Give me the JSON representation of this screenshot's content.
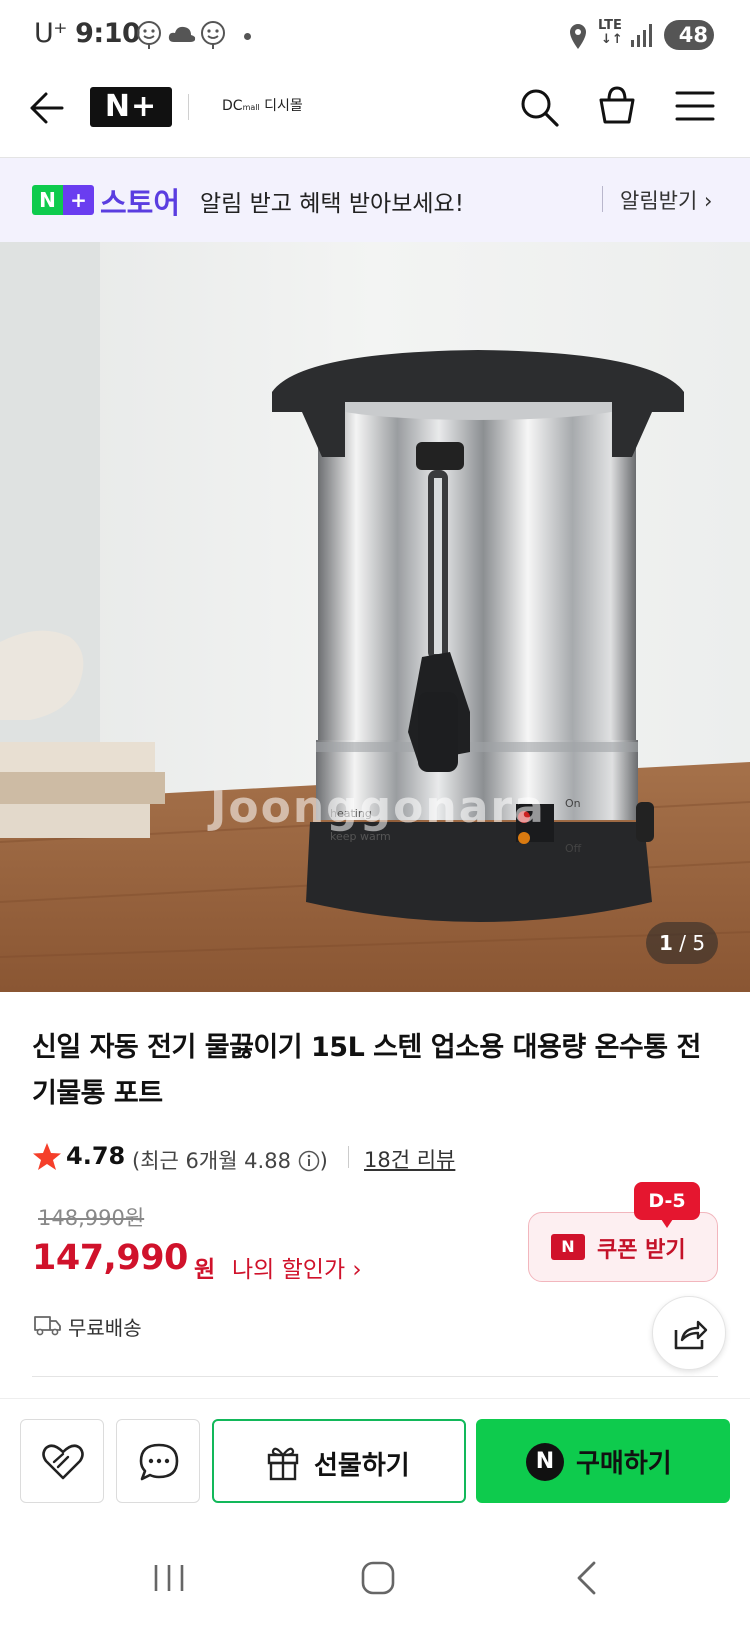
{
  "status_bar": {
    "carrier": "U⁺",
    "time": "9:10",
    "network": "LTE",
    "battery": "48"
  },
  "nav": {
    "brand": "N+",
    "store_name": "디시몰",
    "store_prefix": "DC",
    "store_mall": "mall"
  },
  "banner": {
    "badge_left": "N",
    "badge_right": "+",
    "store": "스토어",
    "message": "알림 받고 혜택 받아보세요!",
    "link": "알림받기 ›"
  },
  "gallery": {
    "current": "1",
    "total": "5",
    "separator": " / ",
    "watermark": "Joonggonara"
  },
  "product": {
    "title": "신일 자동 전기 물끓이기 15L 스텐 업소용 대용량 온수통 전기물통 포트",
    "rating": "4.78",
    "recent_rating_prefix": "(최근 6개월 4.88",
    "recent_rating_suffix": ")",
    "review_count": "18건 리뷰",
    "original_price": "148,990원",
    "price": "147,990",
    "currency": "원",
    "my_discount": "나의 할인가 ›",
    "shipping": "무료배송"
  },
  "coupon": {
    "dday": "D-5",
    "label": "쿠폰 받기",
    "badge": "N"
  },
  "actions": {
    "gift": "선물하기",
    "buy": "구매하기",
    "buy_badge": "N"
  },
  "colors": {
    "accent_green": "#0ecb4d",
    "price_red": "#d0122b",
    "store_purple": "#5a3de0",
    "banner_bg": "#f3f2fd"
  }
}
